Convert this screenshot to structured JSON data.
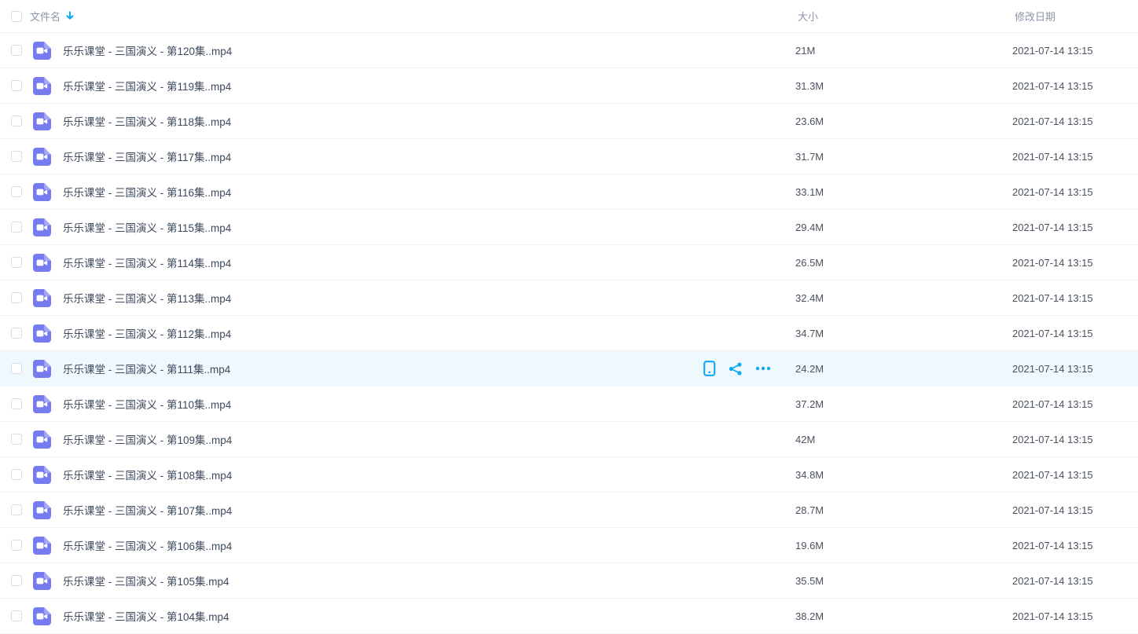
{
  "header": {
    "name_label": "文件名",
    "size_label": "大小",
    "date_label": "修改日期",
    "sort_icon": "arrow-down",
    "sort_direction": "descending"
  },
  "colors": {
    "accent": "#12a9f2",
    "file_icon": "#777bf0",
    "file_icon_fold": "#a6a8f4",
    "hover_row_bg": "#eff8fd"
  },
  "row_actions": {
    "send_to_device_icon": "phone",
    "share_icon": "share-nodes",
    "more_icon": "ellipsis"
  },
  "rows": [
    {
      "name": "乐乐课堂 - 三国演义 - 第120集..mp4",
      "size": "21M",
      "date": "2021-07-14 13:15",
      "hovered": false
    },
    {
      "name": "乐乐课堂 - 三国演义 - 第119集..mp4",
      "size": "31.3M",
      "date": "2021-07-14 13:15",
      "hovered": false
    },
    {
      "name": "乐乐课堂 - 三国演义 - 第118集..mp4",
      "size": "23.6M",
      "date": "2021-07-14 13:15",
      "hovered": false
    },
    {
      "name": "乐乐课堂 - 三国演义 - 第117集..mp4",
      "size": "31.7M",
      "date": "2021-07-14 13:15",
      "hovered": false
    },
    {
      "name": "乐乐课堂 - 三国演义 - 第116集..mp4",
      "size": "33.1M",
      "date": "2021-07-14 13:15",
      "hovered": false
    },
    {
      "name": "乐乐课堂 - 三国演义 - 第115集..mp4",
      "size": "29.4M",
      "date": "2021-07-14 13:15",
      "hovered": false
    },
    {
      "name": "乐乐课堂 - 三国演义 - 第114集..mp4",
      "size": "26.5M",
      "date": "2021-07-14 13:15",
      "hovered": false
    },
    {
      "name": "乐乐课堂 - 三国演义 - 第113集..mp4",
      "size": "32.4M",
      "date": "2021-07-14 13:15",
      "hovered": false
    },
    {
      "name": "乐乐课堂 - 三国演义 - 第112集..mp4",
      "size": "34.7M",
      "date": "2021-07-14 13:15",
      "hovered": false
    },
    {
      "name": "乐乐课堂 - 三国演义 - 第111集..mp4",
      "size": "24.2M",
      "date": "2021-07-14 13:15",
      "hovered": true
    },
    {
      "name": "乐乐课堂 - 三国演义 - 第110集..mp4",
      "size": "37.2M",
      "date": "2021-07-14 13:15",
      "hovered": false
    },
    {
      "name": "乐乐课堂 - 三国演义 - 第109集..mp4",
      "size": "42M",
      "date": "2021-07-14 13:15",
      "hovered": false
    },
    {
      "name": "乐乐课堂 - 三国演义 - 第108集..mp4",
      "size": "34.8M",
      "date": "2021-07-14 13:15",
      "hovered": false
    },
    {
      "name": "乐乐课堂 - 三国演义 - 第107集..mp4",
      "size": "28.7M",
      "date": "2021-07-14 13:15",
      "hovered": false
    },
    {
      "name": "乐乐课堂 - 三国演义 - 第106集..mp4",
      "size": "19.6M",
      "date": "2021-07-14 13:15",
      "hovered": false
    },
    {
      "name": "乐乐课堂 - 三国演义 - 第105集.mp4",
      "size": "35.5M",
      "date": "2021-07-14 13:15",
      "hovered": false
    },
    {
      "name": "乐乐课堂 - 三国演义 - 第104集.mp4",
      "size": "38.2M",
      "date": "2021-07-14 13:15",
      "hovered": false
    }
  ]
}
